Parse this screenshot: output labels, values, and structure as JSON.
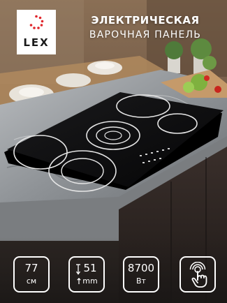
{
  "brand": {
    "name": "LEX"
  },
  "headline": {
    "line1": "ЭЛЕКТРИЧЕСКАЯ",
    "line2": "ВАРОЧНАЯ ПАНЕЛЬ"
  },
  "badges": [
    {
      "value": "77",
      "unit": "см",
      "icon": "width-icon"
    },
    {
      "value": "51",
      "unit": "mm",
      "icon": "height-arrow-icon"
    },
    {
      "value": "8700",
      "unit": "Вт",
      "icon": "power-icon"
    },
    {
      "value": "",
      "unit": "",
      "icon": "touch-control-icon"
    }
  ],
  "colors": {
    "accent_red": "#e0262c",
    "badge_border": "#ffffff",
    "text_light": "#ffffff",
    "hob_black": "#0b0b0c"
  }
}
